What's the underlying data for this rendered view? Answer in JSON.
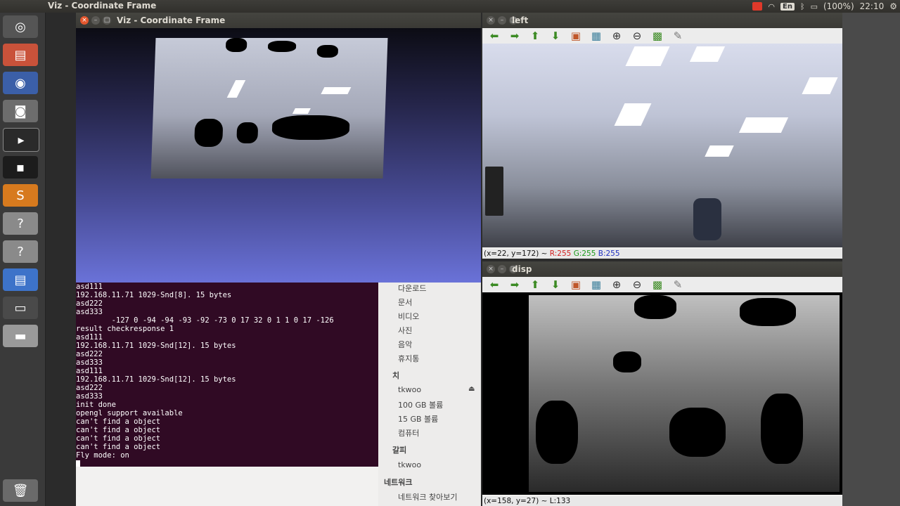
{
  "topbar": {
    "app_title": "Viz - Coordinate Frame",
    "lang": "En",
    "battery": "(100%)",
    "clock": "22:10"
  },
  "launcher": {
    "icons": [
      "ubuntu-dash-icon",
      "files-icon",
      "firefox-icon",
      "camera-icon",
      "terminal-icon",
      "terminal-dark-icon",
      "sublime-icon",
      "unknown-app-icon",
      "unknown-app-icon-2",
      "document-icon",
      "usb-drive-icon",
      "disk-icon",
      "trash-icon"
    ]
  },
  "viz_window": {
    "title": "Viz - Coordinate Frame"
  },
  "terminal": {
    "lines": [
      "asd111",
      "192.168.11.71 1029-Snd[8]. 15 bytes",
      "asd222",
      "asd333",
      "        -127 0 -94 -94 -93 -92 -73 0 17 32 0 1 1 0 17 -126",
      "result checkresponse 1",
      "asd111",
      "192.168.11.71 1029-Snd[12]. 15 bytes",
      "asd222",
      "asd333",
      "asd111",
      "192.168.11.71 1029-Snd[12]. 15 bytes",
      "asd222",
      "asd333",
      "init done",
      "opengl support available",
      "can't find a object",
      "can't find a object",
      "can't find a object",
      "can't find a object",
      "Fly mode: on"
    ]
  },
  "files_sidebar": {
    "items": [
      "다운로드",
      "문서",
      "비디오",
      "사진",
      "음악",
      "휴지통"
    ],
    "section_devices": "치",
    "devices": [
      "tkwoo",
      "100 GB 볼륨",
      "15 GB 볼륨",
      "컴퓨터"
    ],
    "section_bookmarks": "갈피",
    "bookmarks": [
      "tkwoo"
    ],
    "section_network": "네트워크",
    "network": [
      "네트워크 찾아보기"
    ]
  },
  "left_window": {
    "title": "left",
    "status_prefix": "(x=22, y=172) ~ ",
    "r": "R:255",
    "g": "G:255",
    "b": "B:255"
  },
  "disp_window": {
    "title": "disp",
    "status": "(x=158, y=27) ~ L:133"
  },
  "colors": {
    "terminal_bg": "#300a24",
    "r_color": "#d21f1f",
    "g_color": "#1a9a1a",
    "b_color": "#2030c0"
  }
}
